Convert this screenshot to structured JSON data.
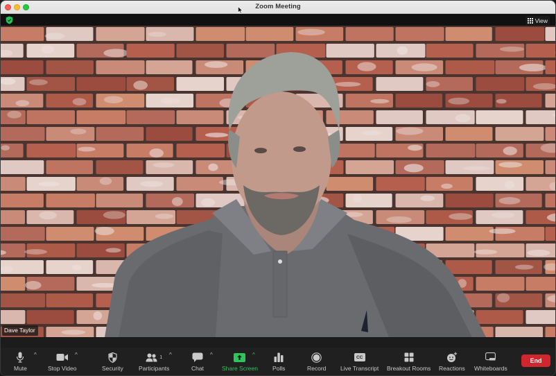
{
  "window": {
    "title": "Zoom Meeting"
  },
  "topbar": {
    "encryption_icon": "shield-check-icon",
    "view_label": "View",
    "view_icon": "grid-icon"
  },
  "video": {
    "participant_name": "Dave Taylor",
    "background": "brick-wall"
  },
  "toolbar": {
    "items": [
      {
        "id": "mute",
        "label": "Mute",
        "icon": "microphone-icon",
        "has_caret": true
      },
      {
        "id": "stop-video",
        "label": "Stop Video",
        "icon": "video-camera-icon",
        "has_caret": true
      },
      {
        "id": "security",
        "label": "Security",
        "icon": "shield-icon",
        "has_caret": false
      },
      {
        "id": "participants",
        "label": "Participants",
        "icon": "participants-icon",
        "count": "1",
        "has_caret": true
      },
      {
        "id": "chat",
        "label": "Chat",
        "icon": "chat-bubble-icon",
        "has_caret": true
      },
      {
        "id": "share-screen",
        "label": "Share Screen",
        "icon": "share-screen-icon",
        "has_caret": true
      },
      {
        "id": "polls",
        "label": "Polls",
        "icon": "bar-chart-icon",
        "has_caret": false
      },
      {
        "id": "record",
        "label": "Record",
        "icon": "record-icon",
        "has_caret": false
      },
      {
        "id": "live-transcript",
        "label": "Live Transcript",
        "icon": "cc-icon",
        "icon_text": "CC",
        "has_caret": false
      },
      {
        "id": "breakout-rooms",
        "label": "Breakout Rooms",
        "icon": "breakout-grid-icon",
        "has_caret": false
      },
      {
        "id": "reactions",
        "label": "Reactions",
        "icon": "smiley-plus-icon",
        "has_caret": false
      },
      {
        "id": "whiteboards",
        "label": "Whiteboards",
        "icon": "whiteboard-icon",
        "has_caret": false
      }
    ],
    "end_label": "End",
    "caret_glyph": "^"
  },
  "colors": {
    "share_accent": "#2ec55a",
    "end_button": "#d0262d",
    "encryption_green": "#23c552",
    "toolbar_bg": "#202020"
  }
}
